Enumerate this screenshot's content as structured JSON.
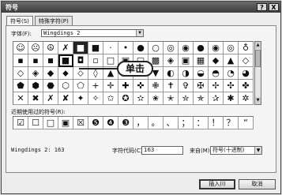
{
  "window": {
    "title": "符号",
    "help_label": "?",
    "close_label": "X"
  },
  "tabs": [
    {
      "label": "符号(S)"
    },
    {
      "label": "特殊字符(P)"
    }
  ],
  "font": {
    "label": "字体(F):",
    "value": "Wingdings 2"
  },
  "symbol_grid": {
    "rows": [
      [
        "☺",
        "☹",
        "☮",
        "✗",
        "■",
        "■",
        "·",
        "•",
        "●",
        "○",
        "◎",
        "◉",
        "●",
        "◉",
        "◎",
        "♁"
      ],
      [
        "▪",
        "▪",
        "◾",
        "■",
        "◘",
        "▫",
        "□",
        "▣",
        "▢",
        "▩",
        "◈",
        "▣",
        "▦",
        "◆",
        "▲",
        "◇"
      ],
      [
        "◇",
        "◈",
        "◆",
        "⬥",
        "⬦",
        "◊",
        "▲",
        "▶",
        "◀",
        "▼",
        "◐",
        "◑",
        "◒",
        "◓",
        "◔",
        "◕"
      ],
      [
        "⬟",
        "⬢",
        "⬣",
        "⬡",
        "⬠",
        "+",
        "✛",
        "✚",
        "✜",
        "✙",
        "✝",
        "✞",
        "✠",
        "✢",
        "✣",
        "✤"
      ],
      [
        "✕",
        "✖",
        "✗",
        "✘",
        "✦",
        "✧",
        "✩",
        "✪",
        "✫",
        "✬",
        "✭",
        "✮",
        "✯",
        "✰",
        "✱",
        "✲"
      ]
    ]
  },
  "callout": {
    "text": "单击"
  },
  "recent": {
    "label": "近期使用过的符号(R):",
    "items": [
      "☑",
      "☐",
      "□",
      "▣",
      "☒",
      "❺",
      "❹",
      "❸",
      "，",
      "。",
      "、",
      "；",
      "：",
      "！",
      "？",
      "“"
    ]
  },
  "status": {
    "name": "Wingdings 2: 163",
    "code_label": "字符代码(C):",
    "code_value": "163",
    "from_label": "来自(M):",
    "from_value": "符号(十进制)"
  },
  "buttons": {
    "insert": "插入(I)",
    "cancel": "取消"
  }
}
